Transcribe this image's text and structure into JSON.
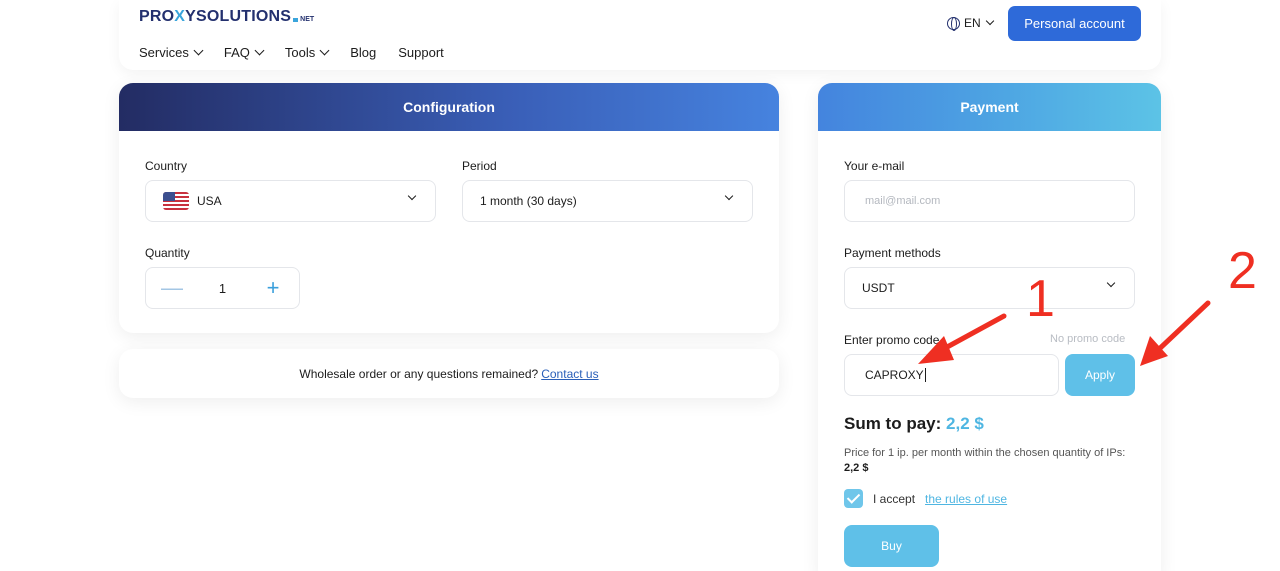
{
  "header": {
    "logo": {
      "part1": "PRO",
      "part2": "X",
      "part3": "YSOLUTIONS",
      "suffix": "NET"
    },
    "nav": [
      {
        "label": "Services",
        "dropdown": true
      },
      {
        "label": "FAQ",
        "dropdown": true
      },
      {
        "label": "Tools",
        "dropdown": true
      },
      {
        "label": "Blog",
        "dropdown": false
      },
      {
        "label": "Support",
        "dropdown": false
      }
    ],
    "language": "EN",
    "account_button": "Personal account"
  },
  "configuration": {
    "title": "Configuration",
    "country_label": "Country",
    "country_value": "USA",
    "period_label": "Period",
    "period_value": "1 month (30 days)",
    "quantity_label": "Quantity",
    "quantity_value": "1",
    "minus": "—",
    "plus": "+"
  },
  "wholesale": {
    "text": "Wholesale order or any questions remained?",
    "link": "Contact us"
  },
  "payment": {
    "title": "Payment",
    "email_label": "Your e-mail",
    "email_placeholder": "mail@mail.com",
    "methods_label": "Payment methods",
    "method_value": "USDT",
    "promo_label": "Enter promo code",
    "no_promo": "No promo code",
    "promo_value": "CAPROXY",
    "apply_button": "Apply",
    "sum_label": "Sum to pay:",
    "sum_value": "2,2 $",
    "price_note": "Price for 1 ip. per month within the chosen quantity of IPs:",
    "price_value": "2,2 $",
    "accept_text": "I accept",
    "rules_link": "the rules of use",
    "buy_button": "Buy"
  },
  "annotations": {
    "label1": "1",
    "label2": "2",
    "color": "#ef2f22"
  }
}
